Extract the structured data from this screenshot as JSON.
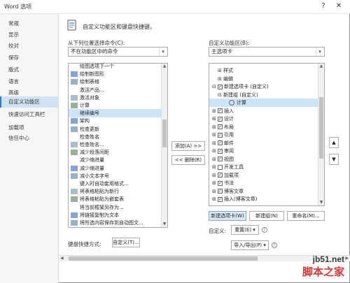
{
  "window": {
    "title": "Word 选项",
    "help": "?",
    "close": "✕"
  },
  "sidebar": {
    "items": [
      {
        "label": "常规"
      },
      {
        "label": "显示"
      },
      {
        "label": "校对"
      },
      {
        "label": "保存"
      },
      {
        "label": "版式"
      },
      {
        "label": "语言"
      },
      {
        "label": "高级"
      },
      {
        "label": "自定义功能区",
        "active": true
      },
      {
        "label": "快速访问工具栏"
      },
      {
        "label": "加载项"
      },
      {
        "label": "信任中心"
      }
    ]
  },
  "header": {
    "title": "自定义功能区和键盘快捷键。"
  },
  "left": {
    "choose_label": "从下列位置选择命令(C):",
    "choose_value": "不在功能区中的命令",
    "commands": [
      "绘图选项下一个",
      "绘制新图形",
      "绘制表格",
      "激活产品...",
      "激活对象",
      "计算",
      "继续编号",
      "架构",
      "检查更新",
      "检查姓名",
      "检查姓名...",
      "减少段落间距",
      "减少缩进量",
      "减少缩进量",
      "减小文本字号",
      "键入时自动套用格式...",
      "将表格粘贴为新行",
      "将表格粘贴为嵌套表",
      "将当前框架另存为...",
      "将链接复制为文本",
      "将所选内容保存到自动图文..."
    ],
    "selected_command": "继续编号"
  },
  "middle": {
    "add_button": "添加(A) >>",
    "remove_button": "<< 删除(R)"
  },
  "right": {
    "customize_label": "自定义功能区(B):",
    "customize_value": "主选项卡",
    "tree": [
      {
        "text": "样式",
        "level": 2,
        "expander": "⊞",
        "checkbox": false
      },
      {
        "text": "编辑",
        "level": 2,
        "expander": "⊞",
        "checkbox": false
      },
      {
        "text": "新建选项卡 (自定义)",
        "level": 1,
        "expander": "⊟",
        "checkbox": true
      },
      {
        "text": "新建组 (自定义)",
        "level": 2,
        "expander": "⊟",
        "checkbox": false
      },
      {
        "text": "计算",
        "level": 3,
        "expander": "",
        "checkbox": false,
        "selected": true
      },
      {
        "text": "插入",
        "level": 1,
        "expander": "⊞",
        "checkbox": true
      },
      {
        "text": "设计",
        "level": 1,
        "expander": "⊞",
        "checkbox": true
      },
      {
        "text": "布局",
        "level": 1,
        "expander": "⊞",
        "checkbox": true
      },
      {
        "text": "引用",
        "level": 1,
        "expander": "⊞",
        "checkbox": true
      },
      {
        "text": "邮件",
        "level": 1,
        "expander": "⊞",
        "checkbox": true
      },
      {
        "text": "审阅",
        "level": 1,
        "expander": "⊞",
        "checkbox": true
      },
      {
        "text": "视图",
        "level": 1,
        "expander": "⊞",
        "checkbox": true
      },
      {
        "text": "开发工具",
        "level": 1,
        "expander": "⊞",
        "checkbox": false
      },
      {
        "text": "加载项",
        "level": 1,
        "expander": "⊞",
        "checkbox": true
      },
      {
        "text": "书法",
        "level": 1,
        "expander": "⊞",
        "checkbox": true
      },
      {
        "text": "博客文章",
        "level": 1,
        "expander": "⊞",
        "checkbox": true
      },
      {
        "text": "插入(博客文章)",
        "level": 1,
        "expander": "⊞",
        "checkbox": true
      }
    ],
    "new_tab_button": "新建选项卡(W)",
    "new_group_button": "新建组(N)",
    "rename_button": "重命名(M)...",
    "customize_text": "自定义:",
    "reset_button": "重置(E) ▾",
    "import_export_button": "导入/导出(P) ▾"
  },
  "keyboard": {
    "label": "键盘快捷方式:",
    "button": "自定义(T)..."
  },
  "watermark": {
    "line1": "jb51.net",
    "line2": "脚本之家"
  },
  "colors": {
    "accent": "#2b7cd3",
    "selected": "#cce4f7",
    "sidebar_active": "#cfe3f4"
  }
}
